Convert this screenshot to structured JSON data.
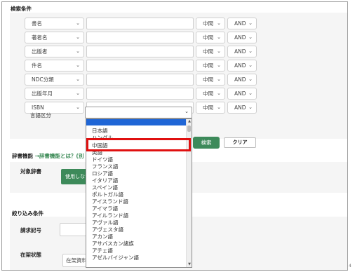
{
  "search_conditions": {
    "title": "検索条件",
    "rows": [
      {
        "field": "書名",
        "match": "中間",
        "op": "AND"
      },
      {
        "field": "著者名",
        "match": "中間",
        "op": "AND"
      },
      {
        "field": "出版者",
        "match": "中間",
        "op": "AND"
      },
      {
        "field": "件名",
        "match": "中間",
        "op": "AND"
      },
      {
        "field": "NDC分類",
        "match": "中間",
        "op": "AND"
      },
      {
        "field": "出版年月",
        "match": "中間",
        "op": "AND"
      },
      {
        "field": "ISBN",
        "match": "中間",
        "op": "AND"
      }
    ],
    "language_label": "言語区分",
    "search_button": "検索",
    "clear_button": "クリア"
  },
  "dictionary": {
    "title": "辞書機能",
    "link": "→辞書機能とは？(別",
    "target_label": "対象辞書",
    "use_button": "使用しない"
  },
  "filter": {
    "title": "絞り込み条件",
    "request_label": "請求記号",
    "status_label": "在架状態",
    "status_value": "在架資料のみ"
  },
  "language_dropdown": {
    "selected": "",
    "options": [
      "日本語",
      "ハングル",
      "中国語",
      "英語",
      "ドイツ語",
      "フランス語",
      "ロシア語",
      "イタリア語",
      "スペイン語",
      "ポルトガル語",
      "アイスランド語",
      "アイマラ語",
      "アイルランド語",
      "アヴァル語",
      "アヴェスタ語",
      "アカン語",
      "アサバスカン諸族",
      "アチェ語",
      "アゼルバイジャン語"
    ],
    "highlighted_option": "中国語"
  },
  "colors": {
    "accent_green": "#3d8a5a",
    "highlight_blue": "#1f66d6",
    "annotation_red": "#e01010"
  },
  "page_number": "4"
}
